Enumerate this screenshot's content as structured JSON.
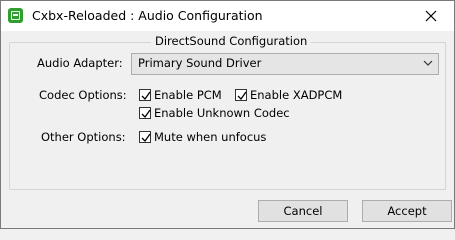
{
  "window": {
    "title": "Cxbx-Reloaded : Audio Configuration"
  },
  "group": {
    "title": "DirectSound Configuration"
  },
  "audio_adapter": {
    "label": "Audio Adapter:",
    "value": "Primary Sound Driver"
  },
  "codec_options": {
    "label": "Codec Options:",
    "pcm": {
      "label": "Enable PCM",
      "checked": true
    },
    "xadpcm": {
      "label": "Enable XADPCM",
      "checked": true
    },
    "unknown": {
      "label": "Enable Unknown Codec",
      "checked": true
    }
  },
  "other_options": {
    "label": "Other Options:",
    "mute": {
      "label": "Mute when unfocus",
      "checked": true
    }
  },
  "buttons": {
    "cancel": "Cancel",
    "accept": "Accept"
  }
}
